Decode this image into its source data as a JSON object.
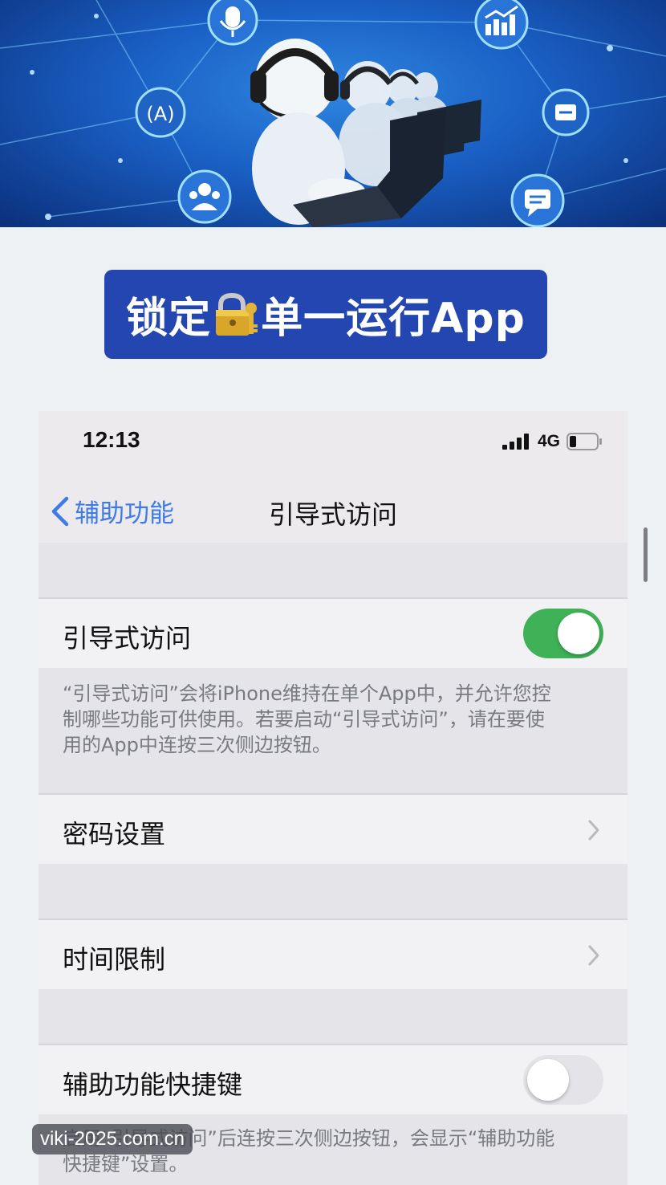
{
  "banner": {
    "icons": [
      "microphone-icon",
      "chart-icon",
      "translate-icon",
      "edit-icon",
      "users-icon",
      "chat-icon",
      "headset-agents-illustration"
    ]
  },
  "title": {
    "part1": "锁定",
    "part2": "单一运行App",
    "icon": "lock-key-emoji",
    "background": "#2446b0"
  },
  "status_bar": {
    "time": "12:13",
    "network": "4G",
    "battery_level": 0.25
  },
  "nav": {
    "back_label": "辅助功能",
    "title": "引导式访问",
    "accent": "#3e7be6"
  },
  "settings": {
    "guided_access": {
      "label": "引导式访问",
      "enabled": true,
      "on_color": "#3fb157",
      "description_lines": [
        "“引导式访问”会将iPhone维持在单个App中，并允许您控",
        "制哪些功能可供使用。若要启动“引导式访问”，请在要使",
        "用的App中连按三次侧边按钮。"
      ]
    },
    "passcode": {
      "label": "密码设置"
    },
    "time_limits": {
      "label": "时间限制"
    },
    "accessibility_shortcut": {
      "label": "辅助功能快捷键",
      "enabled": false,
      "description_lines": [
        "启用“引导式访问”后连按三次侧边按钮，会显示“辅助功能",
        "快捷键”设置。"
      ]
    }
  },
  "watermark": "viki-2025.com.cn"
}
